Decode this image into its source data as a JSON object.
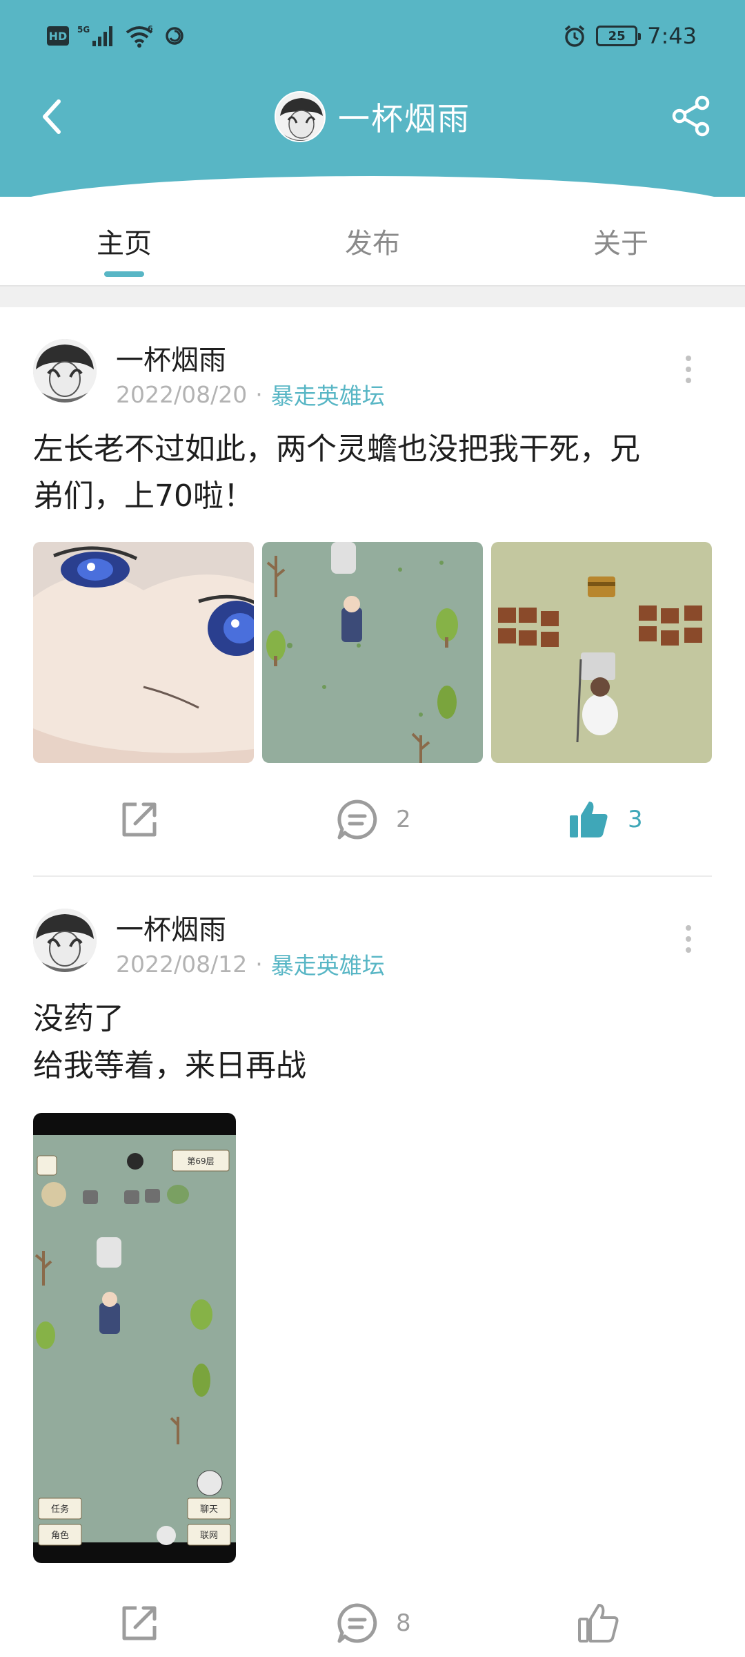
{
  "status_bar": {
    "left_icons": [
      "hd-icon",
      "5g-signal-icon",
      "wifi-icon",
      "sync-icon"
    ],
    "hd_label": "HD",
    "net_label": "5G",
    "wifi_label": "6",
    "battery": "25",
    "time": "7:43"
  },
  "header": {
    "title": "一杯烟雨",
    "back_icon": "chevron-left-icon",
    "share_icon": "share-icon"
  },
  "tabs": [
    {
      "label": "主页",
      "active": true
    },
    {
      "label": "发布",
      "active": false
    },
    {
      "label": "关于",
      "active": false
    }
  ],
  "posts": [
    {
      "author": "一杯烟雨",
      "date": "2022/08/20",
      "forum": "暴走英雄坛",
      "text_lines": [
        "左长老不过如此，两个灵蟾也没把我干死，兄",
        "弟们，上70啦！"
      ],
      "images": [
        "anime-face-image",
        "game-map-image",
        "game-battle-image"
      ],
      "comments": "2",
      "likes": "3",
      "liked": true
    },
    {
      "author": "一杯烟雨",
      "date": "2022/08/12",
      "forum": "暴走英雄坛",
      "text_lines": [
        "没药了",
        "给我等着，来日再战"
      ],
      "images": [
        "game-screenshot-image"
      ],
      "game_labels": {
        "floor": "第69层",
        "task": "任务",
        "role": "角色",
        "chat": "聊天",
        "network": "联网"
      },
      "comments": "8",
      "likes": "",
      "liked": false
    }
  ],
  "colors": {
    "accent": "#58b6c5",
    "like_active": "#3fa7b8",
    "meta_gray": "#b3b3b3"
  }
}
